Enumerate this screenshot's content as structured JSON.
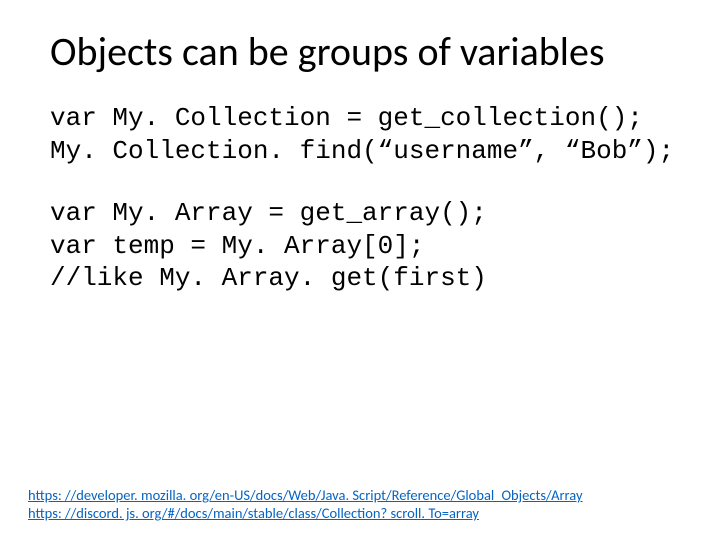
{
  "title": "Objects can be groups of variables",
  "code": {
    "l1": "var My. Collection = get_collection();",
    "l2": "My. Collection. find(“username”, “Bob”);",
    "l3": "var My. Array = get_array();",
    "l4": "var temp = My. Array[0];",
    "l5": "//like My. Array. get(first)"
  },
  "links": {
    "a": "https: //developer. mozilla. org/en-US/docs/Web/Java. Script/Reference/Global_Objects/Array",
    "b": "https: //discord. js. org/#/docs/main/stable/class/Collection? scroll. To=array"
  }
}
